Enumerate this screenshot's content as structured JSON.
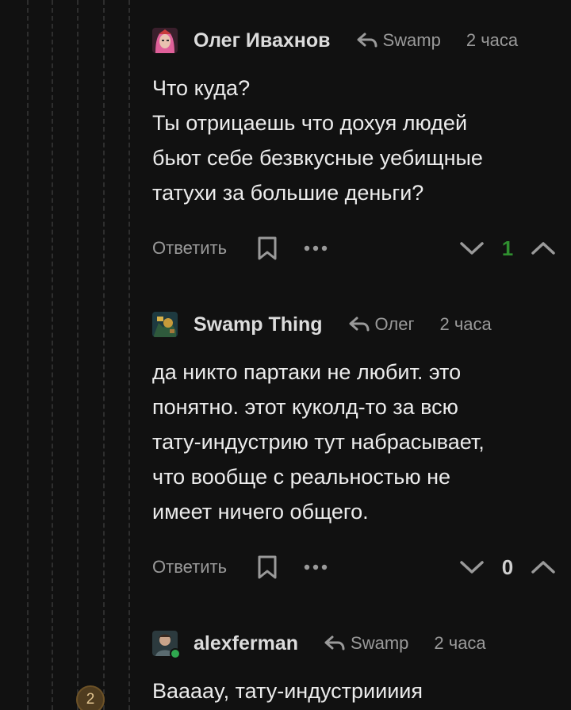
{
  "colors": {
    "background": "#111111",
    "positive_rating": "#2f8f2f",
    "neutral_rating": "#cfcfcf",
    "badge_bg": "#4f3c1f",
    "online": "#2fa84f"
  },
  "thread": {
    "collapsed_count": "2"
  },
  "comments": [
    {
      "author": "Олег Ивахнов",
      "reply_to": "Swamp",
      "time": "2 часа",
      "avatar_icon": "avatar-pink-hair",
      "text": [
        "Что куда?",
        "Ты отрицаешь что дохуя людей",
        "бьют себе безвкусные уебищные",
        "татухи за большие деньги?"
      ],
      "reply_label": "Ответить",
      "rating": "1",
      "rating_color": "#2f8f2f"
    },
    {
      "author": "Swamp Thing",
      "reply_to": "Олег",
      "time": "2 часа",
      "avatar_icon": "avatar-swamp-creature",
      "text": [
        "да никто партаки не любит. это",
        "понятно. этот куколд-то за всю",
        "тату-индустрию тут набрасывает,",
        "что вообще с реальностью не",
        "имеет ничего общего."
      ],
      "reply_label": "Ответить",
      "rating": "0",
      "rating_color": "#cfcfcf"
    },
    {
      "author": "alexferman",
      "reply_to": "Swamp",
      "time": "2 часа",
      "avatar_icon": "avatar-person",
      "online": true,
      "text": [
        "Вааааy, тату-индустриииия"
      ]
    }
  ]
}
